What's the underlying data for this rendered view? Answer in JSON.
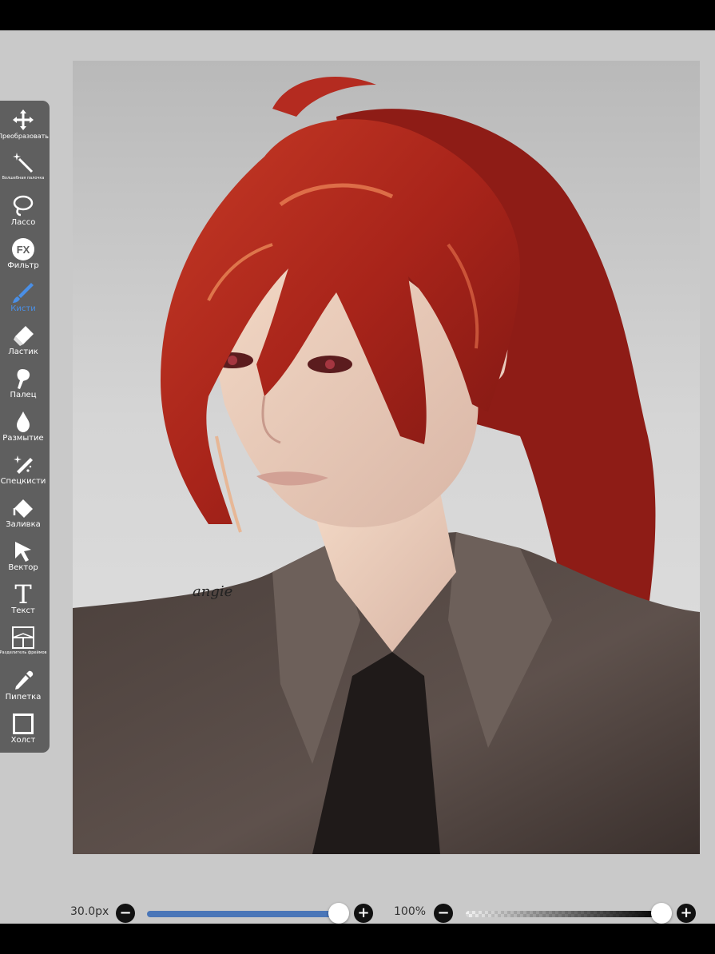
{
  "toolbar": {
    "items": [
      {
        "label": "Преобразовать",
        "icon": "move-arrows-icon"
      },
      {
        "label": "Волшебная палочка",
        "icon": "magic-wand-icon"
      },
      {
        "label": "Лассо",
        "icon": "lasso-icon"
      },
      {
        "label": "Фильтр",
        "icon": "fx-filter-icon",
        "glyph": "FX"
      },
      {
        "label": "Кисти",
        "icon": "brush-icon",
        "active": true
      },
      {
        "label": "Ластик",
        "icon": "eraser-icon"
      },
      {
        "label": "Палец",
        "icon": "smudge-finger-icon"
      },
      {
        "label": "Размытие",
        "icon": "blur-drop-icon"
      },
      {
        "label": "Спецкисти",
        "icon": "special-brush-icon"
      },
      {
        "label": "Заливка",
        "icon": "fill-bucket-icon"
      },
      {
        "label": "Вектор",
        "icon": "vector-arrow-icon"
      },
      {
        "label": "Текст",
        "icon": "text-icon",
        "glyph": "T"
      },
      {
        "label": "Разделитель фреймов",
        "icon": "frame-divider-icon"
      },
      {
        "label": "Пипетка",
        "icon": "eyedropper-icon"
      },
      {
        "label": "Холст",
        "icon": "canvas-icon"
      }
    ]
  },
  "artwork": {
    "signature": "angie"
  },
  "bottom_bar": {
    "brush_size_label": "30.0px",
    "brush_size_fraction": 1.0,
    "opacity_label": "100%",
    "opacity_fraction": 1.0,
    "minus": "−",
    "plus": "+"
  },
  "colors": {
    "accent": "#4a8fe6",
    "toolbar_bg": "#5f5f5f",
    "workspace_bg": "#c9c9c9",
    "slider_fill": "#4a76b8"
  }
}
